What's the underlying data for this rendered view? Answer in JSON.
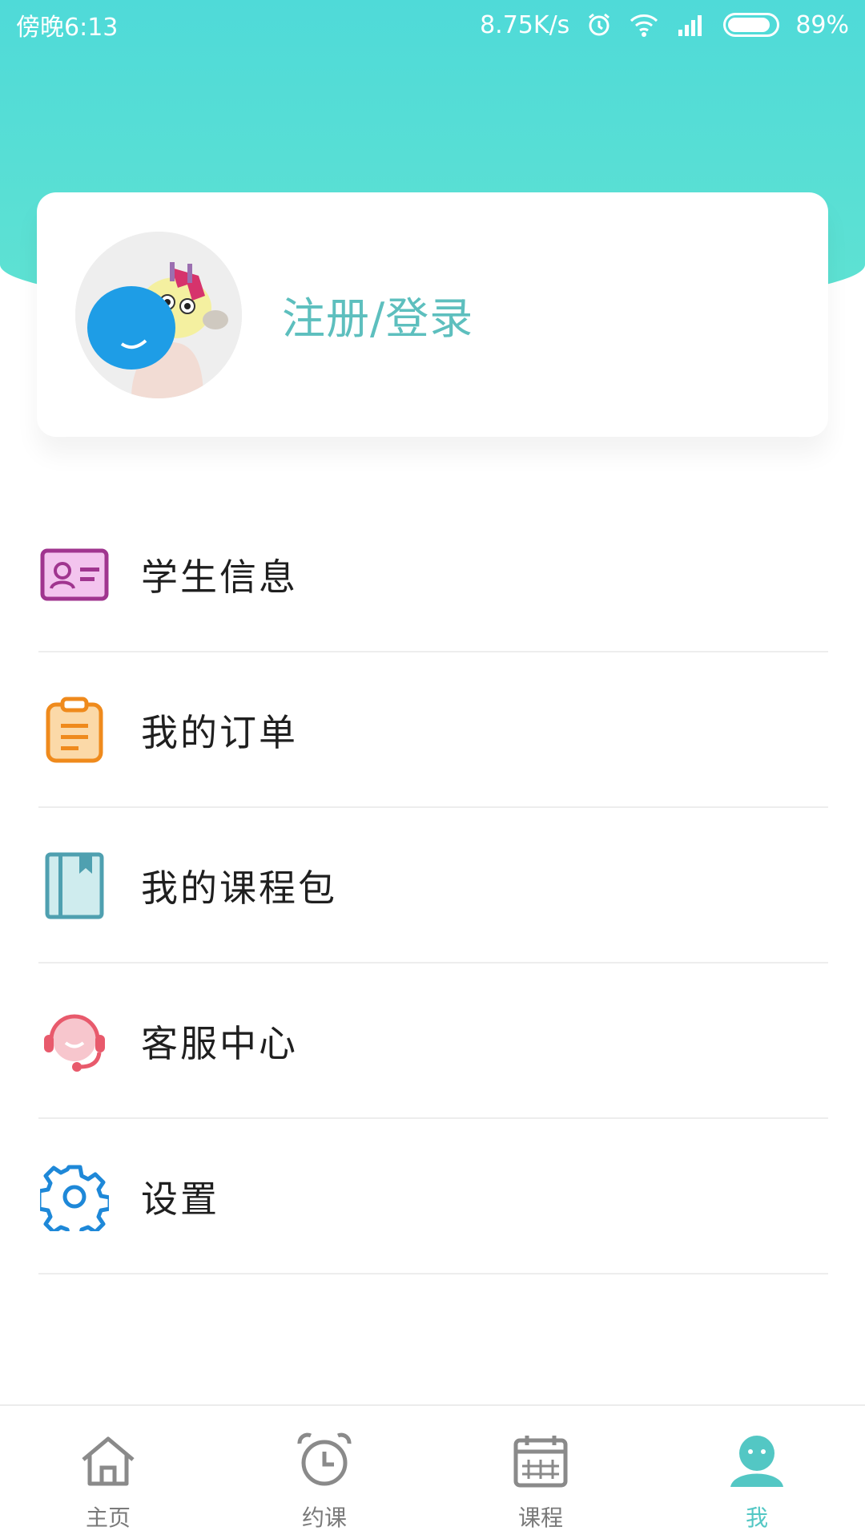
{
  "status_bar": {
    "time": "傍晚6:13",
    "speed": "8.75K/s",
    "battery": "89%",
    "battery_level": 0.89
  },
  "profile": {
    "login_text": "注册/登录"
  },
  "menu": {
    "items": [
      {
        "label": "学生信息",
        "icon": "student-id-card-icon",
        "color": "#a0358f"
      },
      {
        "label": "我的订单",
        "icon": "clipboard-order-icon",
        "color": "#ef8a1c"
      },
      {
        "label": "我的课程包",
        "icon": "course-book-icon",
        "color": "#4fa0b0"
      },
      {
        "label": "客服中心",
        "icon": "customer-service-headset-icon",
        "color": "#e85a6c"
      },
      {
        "label": "设置",
        "icon": "gear-icon",
        "color": "#1e88d8"
      }
    ]
  },
  "tabbar": {
    "tabs": [
      {
        "label": "主页",
        "icon": "home-icon",
        "active": false
      },
      {
        "label": "约课",
        "icon": "alarm-clock-icon",
        "active": false
      },
      {
        "label": "课程",
        "icon": "calendar-icon",
        "active": false
      },
      {
        "label": "我",
        "icon": "user-icon",
        "active": true
      }
    ]
  },
  "colors": {
    "header": "#52dcd6",
    "accent": "#53c7c4",
    "divider": "#ededed"
  }
}
